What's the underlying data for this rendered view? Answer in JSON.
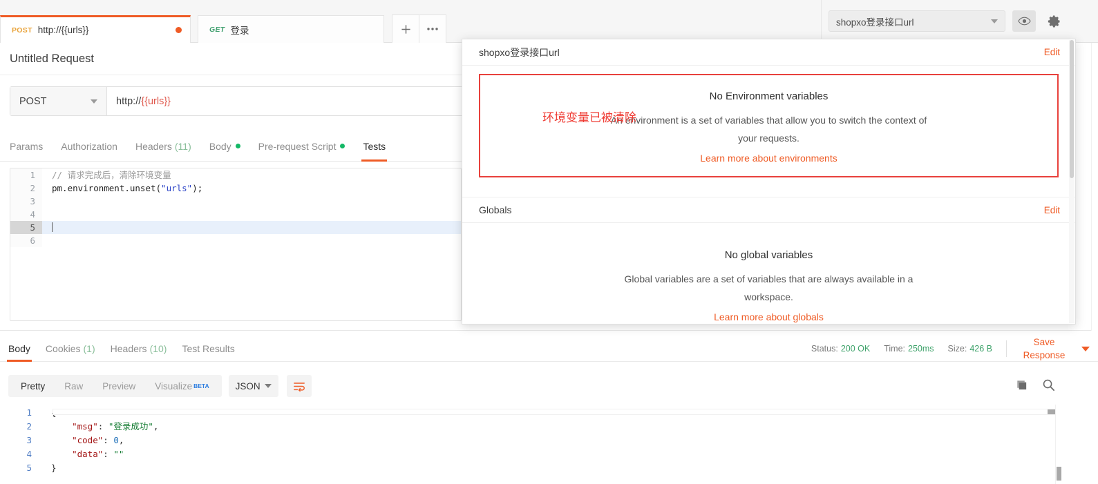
{
  "tabs": [
    {
      "method": "POST",
      "title": "http://{{urls}}",
      "unsaved": true
    },
    {
      "method": "GET",
      "title": "登录",
      "unsaved": false
    }
  ],
  "tabbar": {
    "new_tab_label": "+",
    "more_label": "•••"
  },
  "env_bar": {
    "selected_environment": "shopxo登录接口url",
    "eye_icon": "eye-icon",
    "gear_icon": "gear-icon"
  },
  "request": {
    "name": "Untitled Request",
    "method": "POST",
    "url_prefix": "http://",
    "url_variable": "{{urls}}",
    "tabs": [
      {
        "label": "Params",
        "count": "",
        "dot": false,
        "active": false
      },
      {
        "label": "Authorization",
        "count": "",
        "dot": false,
        "active": false
      },
      {
        "label": "Headers",
        "count": "(11)",
        "dot": false,
        "active": false
      },
      {
        "label": "Body",
        "count": "",
        "dot": true,
        "active": false
      },
      {
        "label": "Pre-request Script",
        "count": "",
        "dot": true,
        "active": false
      },
      {
        "label": "Tests",
        "count": "",
        "dot": false,
        "active": true
      }
    ]
  },
  "script_editor": {
    "lines": [
      {
        "num": "1",
        "comment": "// 请求完成后，清除环境变量",
        "code": "",
        "string": "",
        "tail": "",
        "highlighted": false
      },
      {
        "num": "2",
        "comment": "",
        "code": "pm.environment.unset(",
        "string": "\"urls\"",
        "tail": ");",
        "highlighted": false
      },
      {
        "num": "3",
        "comment": "",
        "code": "",
        "string": "",
        "tail": "",
        "highlighted": false
      },
      {
        "num": "4",
        "comment": "",
        "code": "",
        "string": "",
        "tail": "",
        "highlighted": false
      },
      {
        "num": "5",
        "comment": "",
        "code": "",
        "string": "",
        "tail": "",
        "highlighted": true
      },
      {
        "num": "6",
        "comment": "",
        "code": "",
        "string": "",
        "tail": "",
        "highlighted": false
      }
    ]
  },
  "response": {
    "tabs": [
      {
        "label": "Body",
        "count": "",
        "active": true
      },
      {
        "label": "Cookies",
        "count": "(1)",
        "active": false
      },
      {
        "label": "Headers",
        "count": "(10)",
        "active": false
      },
      {
        "label": "Test Results",
        "count": "",
        "active": false
      }
    ],
    "status_label": "Status:",
    "status_value": "200 OK",
    "time_label": "Time:",
    "time_value": "250ms",
    "size_label": "Size:",
    "size_value": "426 B",
    "save_response_label": "Save Response",
    "viewer": {
      "modes": [
        {
          "label": "Pretty",
          "active": true
        },
        {
          "label": "Raw",
          "active": false
        },
        {
          "label": "Preview",
          "active": false
        },
        {
          "label": "Visualize",
          "active": false,
          "badge": "BETA"
        }
      ],
      "format": "JSON",
      "wrap_icon": "word-wrap-icon",
      "copy_icon": "copy-icon",
      "search_icon": "search-icon"
    },
    "body_lines": [
      {
        "num": "1",
        "key": "",
        "sep": "",
        "value": "{",
        "value_type": "pun",
        "tail": ""
      },
      {
        "num": "2",
        "key": "\"msg\"",
        "sep": ": ",
        "value": "\"登录成功\"",
        "value_type": "str",
        "tail": ","
      },
      {
        "num": "3",
        "key": "\"code\"",
        "sep": ": ",
        "value": "0",
        "value_type": "num",
        "tail": ","
      },
      {
        "num": "4",
        "key": "\"data\"",
        "sep": ": ",
        "value": "\"\"",
        "value_type": "str",
        "tail": ""
      },
      {
        "num": "5",
        "key": "",
        "sep": "",
        "value": "}",
        "value_type": "pun",
        "tail": ""
      }
    ]
  },
  "env_popup": {
    "environment": {
      "title": "shopxo登录接口url",
      "edit_label": "Edit",
      "empty_title": "No Environment variables",
      "empty_desc": "An environment is a set of variables that allow you to switch the context of your requests.",
      "learn_more": "Learn more about environments",
      "annotation": "环境变量已被清除",
      "annotation_color": "#ef3b33",
      "highlight_border_color": "#e8413c"
    },
    "globals": {
      "title": "Globals",
      "edit_label": "Edit",
      "empty_title": "No global variables",
      "empty_desc": "Global variables are a set of variables that are always available in a workspace.",
      "learn_more": "Learn more about globals"
    }
  },
  "colors": {
    "accent_orange": "#ef5b25",
    "method_post": "#e9a33a",
    "method_get": "#3f9f6e",
    "status_green": "#3fa36b",
    "dot_green": "#14b866",
    "annotation_red": "#ef3b33"
  }
}
